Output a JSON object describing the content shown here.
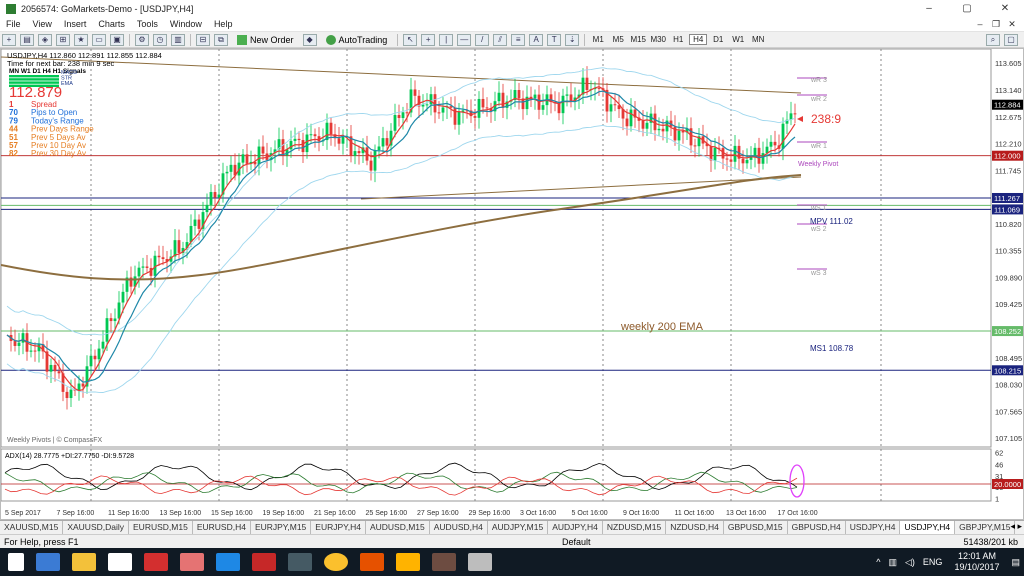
{
  "window": {
    "title": "2056574: GoMarkets-Demo - [USDJPY,H4]",
    "min": "–",
    "max": "▢",
    "close": "✕"
  },
  "menu": [
    "File",
    "View",
    "Insert",
    "Charts",
    "Tools",
    "Window",
    "Help"
  ],
  "toolbar": {
    "new_order": "New Order",
    "autotrading": "AutoTrading",
    "timeframes": [
      "M1",
      "M5",
      "M15",
      "M30",
      "H1",
      "H4",
      "D1",
      "W1",
      "MN"
    ]
  },
  "chart": {
    "header": "USDJPY,H4  112.860 112.891 112.855 112.884",
    "timer": "Time for next bar: 238 min 9 sec",
    "signals_label": "MN W1 D1 H4 H1 Signals",
    "mini_legend": [
      "MACD",
      "STR",
      "EMA"
    ],
    "price_big": "112.879",
    "stats": [
      {
        "value": "1",
        "label": "Spread",
        "color": "#e53935"
      },
      {
        "value": "70",
        "label": "Pips to Open",
        "color": "#1e6fd9"
      },
      {
        "value": "79",
        "label": "Today's Range",
        "color": "#1e6fd9"
      },
      {
        "value": "44",
        "label": "Prev Days Range",
        "color": "#e67e22"
      },
      {
        "value": "51",
        "label": "Prev 5 Days Av",
        "color": "#e67e22"
      },
      {
        "value": "57",
        "label": "Prev 10 Day Av",
        "color": "#e67e22"
      },
      {
        "value": "82",
        "label": "Prev 30 Day Av",
        "color": "#e67e22"
      }
    ],
    "price_axis": [
      "113.605",
      "113.140",
      "112.675",
      "112.210",
      "111.745",
      "111.280",
      "110.820",
      "110.355",
      "109.890",
      "109.425",
      "108.960",
      "108.495",
      "108.030",
      "107.565",
      "107.105"
    ],
    "price_tags": [
      {
        "text": "112.884",
        "bg": "#000000",
        "fg": "#ffffff",
        "price": 112.884
      },
      {
        "text": "112.000",
        "bg": "#b71c1c",
        "fg": "#ffffff",
        "price": 112.0
      },
      {
        "text": "111.267",
        "bg": "#1a237e",
        "fg": "#ffffff",
        "price": 111.267
      },
      {
        "text": "111.069",
        "bg": "#1a237e",
        "fg": "#ffffff",
        "price": 111.069
      },
      {
        "text": "108.252",
        "bg": "#66bb6a",
        "fg": "#ffffff",
        "price": 108.96
      },
      {
        "text": "108.215",
        "bg": "#1a237e",
        "fg": "#ffffff",
        "price": 108.28
      }
    ],
    "time_axis": [
      "5 Sep 2017",
      "7 Sep 16:00",
      "11 Sep 16:00",
      "13 Sep 16:00",
      "15 Sep 16:00",
      "19 Sep 16:00",
      "21 Sep 16:00",
      "25 Sep 16:00",
      "27 Sep 16:00",
      "29 Sep 16:00",
      "3 Oct 16:00",
      "5 Oct 16:00",
      "9 Oct 16:00",
      "11 Oct 16:00",
      "13 Oct 16:00",
      "17 Oct 16:00"
    ],
    "annotations": {
      "timer_text": "238:9",
      "weekly_pivot": "Weekly Pivot",
      "mpv": "MPV  111.02",
      "ms1": "MS1  108.78",
      "wr3": "wR 3",
      "wr2": "wR 2",
      "wr1": "wR 1",
      "ws1": "wS 1",
      "ws2": "wS 2",
      "ws3": "wS 3",
      "ema_label": "weekly 200 EMA",
      "footer": "Weekly Pivots | © CompassFX"
    },
    "adx": {
      "header": "ADX(14) 28.7775 +DI:27.7750 -DI:9.5728",
      "axis": [
        "62",
        "46",
        "31",
        "16",
        "1"
      ],
      "level_tag": "20.0000"
    },
    "colors": {
      "bull": "#00c853",
      "bear": "#e53935",
      "ema200": "#8d6e3f",
      "bb": "#9fd7ee",
      "ema_fast": "#e53935",
      "ema_slow": "#1e88a8"
    }
  },
  "tabs": [
    "XAUUSD,M15",
    "XAUUSD,Daily",
    "EURUSD,M15",
    "EURUSD,H4",
    "EURJPY,M15",
    "EURJPY,H4",
    "AUDUSD,M15",
    "AUDUSD,H4",
    "AUDJPY,M15",
    "AUDJPY,H4",
    "NZDUSD,M15",
    "NZDUSD,H4",
    "GBPUSD,M15",
    "GBPUSD,H4",
    "USDJPY,H4",
    "USDJPY,H4",
    "GBPJPY,M15"
  ],
  "active_tab": 15,
  "status": {
    "help": "For Help, press F1",
    "profile": "Default",
    "connection": "51438/201 kb"
  },
  "taskbar": {
    "lang": "ENG",
    "time": "12:01 AM",
    "date": "19/10/2017"
  }
}
